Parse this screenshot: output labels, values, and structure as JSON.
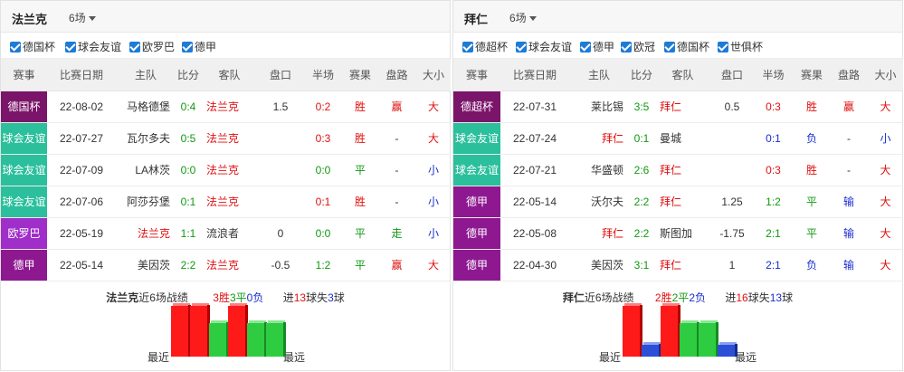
{
  "headers": [
    "赛事",
    "比赛日期",
    "主队",
    "比分",
    "客队",
    "盘口",
    "半场",
    "赛果",
    "盘路",
    "大小"
  ],
  "colors": {
    "red": "#e01010",
    "green": "#119911",
    "blue": "#1a2ecc"
  },
  "left": {
    "team": "法兰克",
    "matches_label": "6场",
    "filters": [
      "德国杯",
      "球会友谊",
      "欧罗巴",
      "德甲"
    ],
    "rows": [
      {
        "comp": "德国杯",
        "comp_color": "#7a1569",
        "date": "22-08-02",
        "home": "马格德堡",
        "score": "0:4",
        "away": "法兰克",
        "handicap": "1.5",
        "half": "0:2",
        "result": "胜",
        "result_color": "#e01010",
        "line": "赢",
        "line_color": "#e01010",
        "ou": "大",
        "ou_color": "#e01010"
      },
      {
        "comp": "球会友谊",
        "comp_color": "#2bbf9c",
        "date": "22-07-27",
        "home": "瓦尔多夫",
        "score": "0:5",
        "away": "法兰克",
        "handicap": "",
        "half": "0:3",
        "result": "胜",
        "result_color": "#e01010",
        "line": "-",
        "line_color": "#333333",
        "ou": "大",
        "ou_color": "#e01010"
      },
      {
        "comp": "球会友谊",
        "comp_color": "#2bbf9c",
        "date": "22-07-09",
        "home": "LA林茨",
        "score": "0:0",
        "away": "法兰克",
        "handicap": "",
        "half": "0:0",
        "result": "平",
        "result_color": "#119911",
        "line": "-",
        "line_color": "#333333",
        "ou": "小",
        "ou_color": "#1a2ecc"
      },
      {
        "comp": "球会友谊",
        "comp_color": "#2bbf9c",
        "date": "22-07-06",
        "home": "阿莎芬堡",
        "score": "0:1",
        "away": "法兰克",
        "handicap": "",
        "half": "0:1",
        "result": "胜",
        "result_color": "#e01010",
        "line": "-",
        "line_color": "#333333",
        "ou": "小",
        "ou_color": "#1a2ecc"
      },
      {
        "comp": "欧罗巴",
        "comp_color": "#a02ec9",
        "date": "22-05-19",
        "home": "法兰克",
        "score": "1:1",
        "away": "流浪者",
        "handicap": "0",
        "half": "0:0",
        "result": "平",
        "result_color": "#119911",
        "line": "走",
        "line_color": "#119911",
        "ou": "小",
        "ou_color": "#1a2ecc"
      },
      {
        "comp": "德甲",
        "comp_color": "#8e1890",
        "date": "22-05-14",
        "home": "美因茨",
        "score": "2:2",
        "away": "法兰克",
        "handicap": "-0.5",
        "half": "1:2",
        "result": "平",
        "result_color": "#119911",
        "line": "赢",
        "line_color": "#e01010",
        "ou": "大",
        "ou_color": "#e01010"
      }
    ],
    "summary": {
      "team": "法兰克",
      "prefix": "近6场战绩",
      "w": "3",
      "w_label": "胜",
      "d": "3",
      "d_label": "平",
      "l": "0",
      "l_label": "负",
      "gf_prefix": "进",
      "gf": "13",
      "gf_label": "球失",
      "ga": "3",
      "ga_label": "球"
    },
    "bars": [
      {
        "result": "win",
        "goals": 4
      },
      {
        "result": "win",
        "goals": 5
      },
      {
        "result": "draw",
        "goals": 0
      },
      {
        "result": "win",
        "goals": 1
      },
      {
        "result": "draw",
        "goals": 1
      },
      {
        "result": "draw",
        "goals": 2
      }
    ],
    "recent_label": "最近",
    "far_label": "最远"
  },
  "right": {
    "team": "拜仁",
    "matches_label": "6场",
    "filters": [
      "德超杯",
      "球会友谊",
      "德甲",
      "欧冠",
      "德国杯",
      "世俱杯"
    ],
    "rows": [
      {
        "comp": "德超杯",
        "comp_color": "#7a1569",
        "date": "22-07-31",
        "home": "莱比锡",
        "score": "3:5",
        "away": "拜仁",
        "handicap": "0.5",
        "half": "0:3",
        "result": "胜",
        "result_color": "#e01010",
        "line": "赢",
        "line_color": "#e01010",
        "ou": "大",
        "ou_color": "#e01010"
      },
      {
        "comp": "球会友谊",
        "comp_color": "#2bbf9c",
        "date": "22-07-24",
        "home": "拜仁",
        "score": "0:1",
        "away": "曼城",
        "handicap": "",
        "half": "0:1",
        "result": "负",
        "result_color": "#1a2ecc",
        "line": "-",
        "line_color": "#333333",
        "ou": "小",
        "ou_color": "#1a2ecc"
      },
      {
        "comp": "球会友谊",
        "comp_color": "#2bbf9c",
        "date": "22-07-21",
        "home": "华盛顿",
        "score": "2:6",
        "away": "拜仁",
        "handicap": "",
        "half": "0:3",
        "result": "胜",
        "result_color": "#e01010",
        "line": "-",
        "line_color": "#333333",
        "ou": "大",
        "ou_color": "#e01010"
      },
      {
        "comp": "德甲",
        "comp_color": "#8e1890",
        "date": "22-05-14",
        "home": "沃尔夫",
        "score": "2:2",
        "away": "拜仁",
        "handicap": "1.25",
        "half": "1:2",
        "result": "平",
        "result_color": "#119911",
        "line": "输",
        "line_color": "#1a2ecc",
        "ou": "大",
        "ou_color": "#e01010"
      },
      {
        "comp": "德甲",
        "comp_color": "#8e1890",
        "date": "22-05-08",
        "home": "拜仁",
        "score": "2:2",
        "away": "斯图加",
        "handicap": "-1.75",
        "half": "2:1",
        "result": "平",
        "result_color": "#119911",
        "line": "输",
        "line_color": "#1a2ecc",
        "ou": "大",
        "ou_color": "#e01010"
      },
      {
        "comp": "德甲",
        "comp_color": "#8e1890",
        "date": "22-04-30",
        "home": "美因茨",
        "score": "3:1",
        "away": "拜仁",
        "handicap": "1",
        "half": "2:1",
        "result": "负",
        "result_color": "#1a2ecc",
        "line": "输",
        "line_color": "#1a2ecc",
        "ou": "大",
        "ou_color": "#e01010"
      }
    ],
    "summary": {
      "team": "拜仁",
      "prefix": "近6场战绩",
      "w": "2",
      "w_label": "胜",
      "d": "2",
      "d_label": "平",
      "l": "2",
      "l_label": "负",
      "gf_prefix": "进",
      "gf": "16",
      "gf_label": "球失",
      "ga": "13",
      "ga_label": "球"
    },
    "bars": [
      {
        "result": "win",
        "goals": 5
      },
      {
        "result": "loss",
        "goals": 0
      },
      {
        "result": "win",
        "goals": 6
      },
      {
        "result": "draw",
        "goals": 2
      },
      {
        "result": "draw",
        "goals": 2
      },
      {
        "result": "loss",
        "goals": 1
      }
    ],
    "recent_label": "最近",
    "far_label": "最远"
  }
}
